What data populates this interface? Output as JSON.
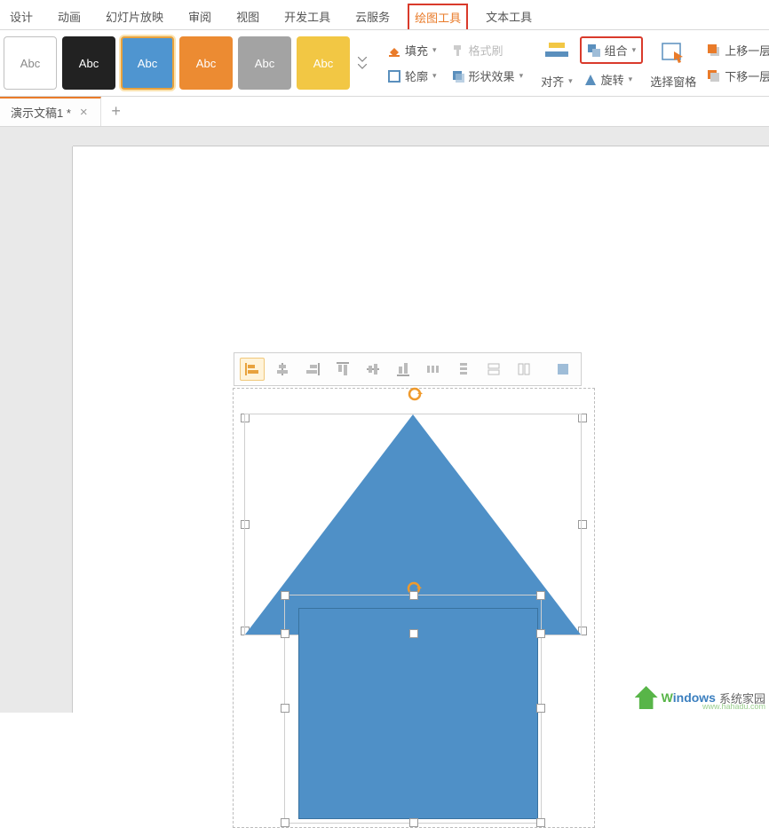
{
  "tabs": {
    "design": "设计",
    "animation": "动画",
    "slideshow": "幻灯片放映",
    "review": "审阅",
    "view": "视图",
    "devtools": "开发工具",
    "cloud": "云服务",
    "drawing_tools": "绘图工具",
    "text_tools": "文本工具"
  },
  "styles": {
    "sample_label": "Abc"
  },
  "ribbon": {
    "fill": "填充",
    "format_painter": "格式刷",
    "outline": "轮廓",
    "shape_effects": "形状效果",
    "align": "对齐",
    "rotate": "旋转",
    "group": "组合",
    "selection_pane": "选择窗格",
    "bring_forward": "上移一层",
    "send_backward": "下移一层"
  },
  "doc": {
    "tab_name": "演示文稿1 *"
  },
  "watermark": {
    "brand": "indows",
    "brand_prefix": "W",
    "suffix": "系统家园",
    "url": "www.hahadu.com"
  },
  "colors": {
    "accent": "#e97b2a",
    "highlight_border": "#d93a2b",
    "shape_fill": "#4f90c7",
    "shape_border": "#39729f"
  }
}
